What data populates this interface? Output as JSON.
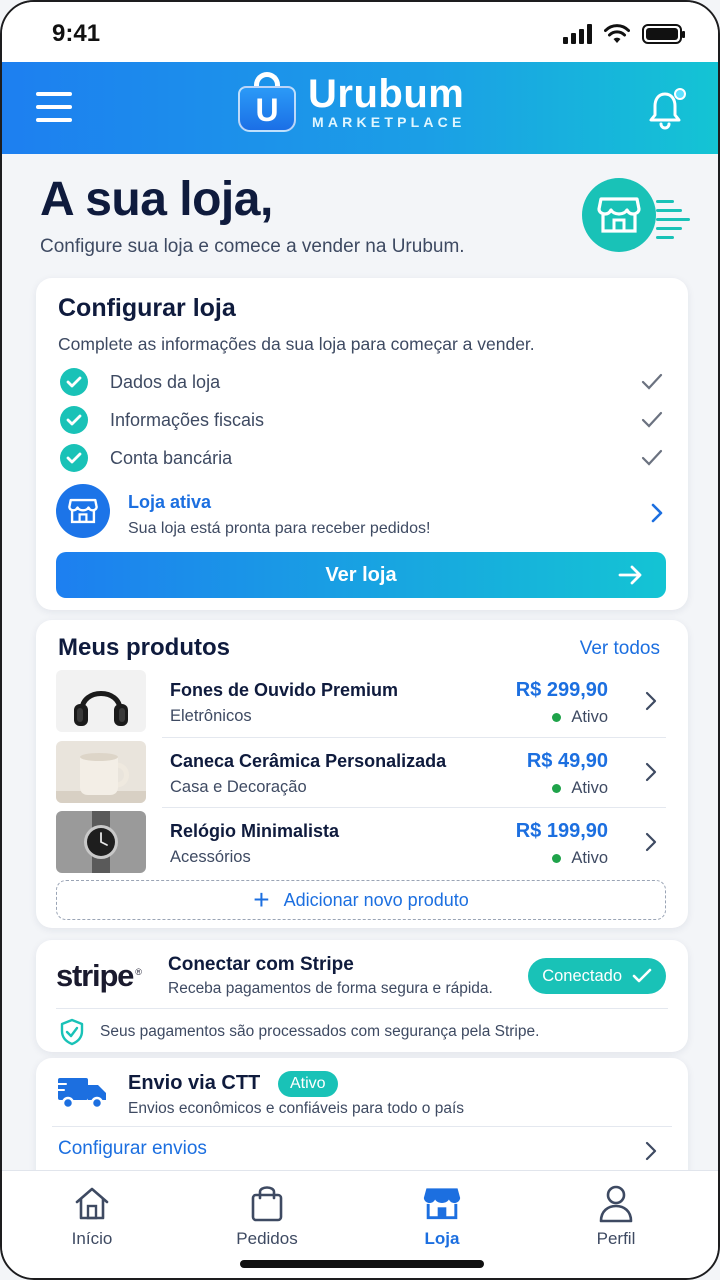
{
  "status_bar": {
    "time": "9:41"
  },
  "header": {
    "logo_letter": "U",
    "brand_name": "Urubum",
    "brand_sub": "MARKETPLACE",
    "colors": {
      "gradient_start": "#1d7ff0",
      "gradient_end": "#14c4d4"
    }
  },
  "hero": {
    "title": "A sua loja,",
    "subtitle": "Configure sua loja e comece a vender na Urubum."
  },
  "setup": {
    "title": "Configurar loja",
    "description": "Complete as informações da sua loja para começar a vender.",
    "steps": [
      {
        "label": "Dados da loja",
        "done": true
      },
      {
        "label": "Informações fiscais",
        "done": true
      },
      {
        "label": "Conta bancária",
        "done": true
      }
    ],
    "status_title": "Loja ativa",
    "status_sub": "Sua loja está pronta para receber pedidos!",
    "cta_label": "Ver loja"
  },
  "products": {
    "title": "Meus produtos",
    "see_all": "Ver todos",
    "items": [
      {
        "name": "Fones de Ouvido Premium",
        "category": "Eletrônicos",
        "price": "R$ 299,90",
        "status": "Ativo",
        "image": "headphones"
      },
      {
        "name": "Caneca Cerâmica Personalizada",
        "category": "Casa e Decoração",
        "price": "R$ 49,90",
        "status": "Ativo",
        "image": "mug"
      },
      {
        "name": "Relógio Minimalista",
        "category": "Acessórios",
        "price": "R$ 199,90",
        "status": "Ativo",
        "image": "watch"
      }
    ],
    "add_label": "Adicionar novo produto"
  },
  "stripe": {
    "logo": "stripe",
    "logo_mark": "®",
    "title": "Conectar com Stripe",
    "subtitle": "Receba pagamentos de forma segura e rápida.",
    "badge": "Conectado",
    "secure_text": "Seus pagamentos são processados com segurança pela Stripe."
  },
  "shipping": {
    "title": "Envio via CTT",
    "badge": "Ativo",
    "subtitle": "Envios econômicos e confiáveis para todo o país",
    "link": "Configurar envios"
  },
  "bottom_nav": {
    "items": [
      {
        "label": "Início",
        "icon": "home-icon"
      },
      {
        "label": "Pedidos",
        "icon": "bag-icon"
      },
      {
        "label": "Loja",
        "icon": "store-icon",
        "active": true
      },
      {
        "label": "Perfil",
        "icon": "user-icon"
      }
    ]
  },
  "colors": {
    "primary": "#1c6fe0",
    "teal": "#19c2b7",
    "active_dot": "#1fa34a",
    "text_dark": "#0f1b3d"
  }
}
